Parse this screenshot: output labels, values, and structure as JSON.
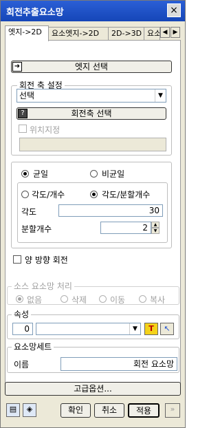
{
  "window": {
    "title": "회전추출요소망",
    "close_icon": "×"
  },
  "tabs": [
    {
      "label": "엣지->2D",
      "active": true
    },
    {
      "label": "요소엣지->2D",
      "active": false
    },
    {
      "label": "2D->3D",
      "active": false
    },
    {
      "label": "요소",
      "active": false
    }
  ],
  "tab_scroll": {
    "left": "◀",
    "right": "▶"
  },
  "edge_select_button": "엣지 선택",
  "rotation_axis": {
    "title": "회전 축 설정",
    "select_value": "선택",
    "axis_select_button": "회전축 선택",
    "help_icon": "?",
    "position_checkbox": "위치지정",
    "position_value": ""
  },
  "division": {
    "uniform": "균일",
    "nonuniform": "비균일",
    "mode_angle_count": "각도/개수",
    "mode_angle_divisions": "각도/분할개수",
    "angle_label": "각도",
    "angle_value": "30",
    "div_count_label": "분할개수",
    "div_count_value": "2",
    "spin_up": "▲",
    "spin_down": "▼"
  },
  "bidirectional": "양 방향 회전",
  "source_mesh": {
    "title": "소스 요소망 처리",
    "none": "없음",
    "delete": "삭제",
    "move": "이동",
    "copy": "복사"
  },
  "property": {
    "title": "속성",
    "number": "0",
    "select_value": "",
    "icon_text": "T",
    "cursor_icon": "↖"
  },
  "mesh_set": {
    "title": "요소망세트",
    "name_label": "이름",
    "name_value": "회전 요소망"
  },
  "advanced_button": "고급옵션...",
  "footer": {
    "ok": "확인",
    "cancel": "취소",
    "apply": "적용",
    "more_icon": "»"
  }
}
